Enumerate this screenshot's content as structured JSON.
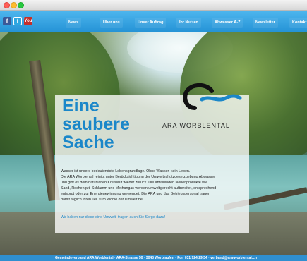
{
  "nav": {
    "social": [
      "f",
      "t",
      "You"
    ],
    "items": [
      {
        "label": "News"
      },
      {
        "label": "Über uns"
      },
      {
        "label": "Unser Auftrag"
      },
      {
        "label": "Ihr Nutzen"
      },
      {
        "label": "Abwasser A-Z"
      },
      {
        "label": "Newsletter"
      },
      {
        "label": "Kontakt"
      }
    ]
  },
  "hero": {
    "headline": [
      "Eine",
      "saubere",
      "Sache"
    ],
    "logo_text": "ARA WORBLENTAL",
    "paragraph_lines": [
      "Wasser ist unsere bedeutendste Lebensgrundlage. Ohne Wasser, kein Leben.",
      "Die ARA Worblental reinigt unter Berücksichtigung der Umweltschutzgesetzgebung Abwasser",
      "und gibt es dem natürlichen Kreislauf wieder zurück. Die anfallenden Nebenprodukte wie",
      "Sand, Rechengut, Schlamm und Methangas werden umweltgerecht aufbereitet, entsprechend",
      "entsorgt oder zur Energiegewinnung verwendet. Die ARA und das Betriebspersonal tragen",
      "damit täglich ihren Teil zum Wohle der Umwelt bei."
    ],
    "tagline": "Wir haben nur diese eine Umwelt, tragen auch Sie Sorge dazu!"
  },
  "footer": {
    "text": "Gemeindeverband ARA Worblental   ·   ARA-Strasse 50   ·   3048 Worblaufen   ·   Fon 031 924 29 34   ·   verband@ara-worblental.ch"
  },
  "colors": {
    "accent": "#1b87c9",
    "nav_bg": "#2593d6"
  }
}
